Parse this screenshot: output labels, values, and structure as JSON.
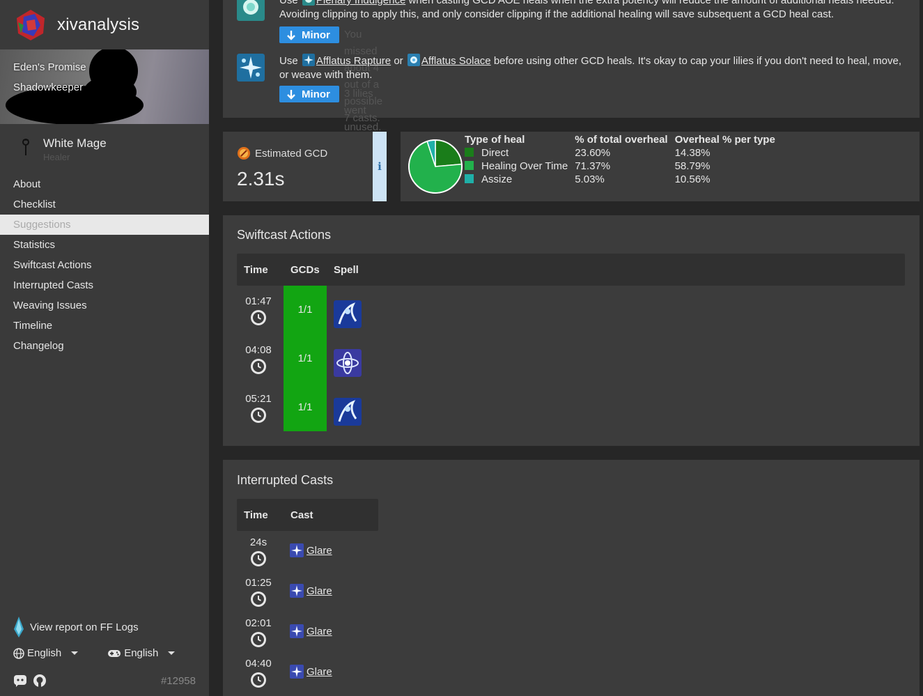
{
  "sidebar": {
    "brand": "xivanalysis",
    "fight_name": "Eden's Promise",
    "fight_sub": "Shadowkeeper",
    "job_name": "White Mage",
    "job_role": "Healer",
    "nav": [
      "About",
      "Checklist",
      "Suggestions",
      "Statistics",
      "Swiftcast Actions",
      "Interrupted Casts",
      "Weaving Issues",
      "Timeline",
      "Changelog"
    ],
    "active_nav": "Suggestions",
    "fflogs_link": "View report on FF Logs",
    "lang_ui": "English",
    "lang_game": "English",
    "version": "#12958"
  },
  "suggestions": [
    {
      "prefix": "Use",
      "spell": "Plenary Indulgence",
      "text": "when casting GCD AOE heals when the extra potency will reduce the amount of additional heals needed. Avoiding clipping to apply this, and only consider clipping if the additional healing will save subsequent a GCD heal cast.",
      "severity": "Minor",
      "note": "You missed about 4 out of a possible 7 casts."
    },
    {
      "prefix": "Use",
      "spell": "Afflatus Rapture",
      "joiner": "or",
      "spell2": "Afflatus Solace",
      "text": "before using other GCD heals. It's okay to cap your lilies if you don't need to heal, move, or weave with them.",
      "severity": "Minor",
      "note": "3 lilies went unused."
    }
  ],
  "gcd": {
    "label": "Estimated GCD",
    "value": "2.31s",
    "info": "i"
  },
  "overheal": {
    "headers": [
      "Type of heal",
      "% of total overheal",
      "Overheal % per type"
    ],
    "rows": [
      {
        "type": "Direct",
        "total": "23.60%",
        "per_type": "14.38%",
        "color": "#1a7d1a"
      },
      {
        "type": "Healing Over Time",
        "total": "71.37%",
        "per_type": "58.79%",
        "color": "#22b14c"
      },
      {
        "type": "Assize",
        "total": "5.03%",
        "per_type": "10.56%",
        "color": "#1fb0a8"
      }
    ],
    "pie": [
      23.6,
      71.37,
      5.03
    ]
  },
  "swiftcast": {
    "title": "Swiftcast Actions",
    "headers": [
      "Time",
      "GCDs",
      "Spell"
    ],
    "rows": [
      {
        "time": "01:47",
        "gcds": "1/1",
        "spell_icon": "raise-icon"
      },
      {
        "time": "04:08",
        "gcds": "1/1",
        "spell_icon": "holy-icon"
      },
      {
        "time": "05:21",
        "gcds": "1/1",
        "spell_icon": "raise-icon"
      }
    ]
  },
  "interrupted": {
    "title": "Interrupted Casts",
    "headers": [
      "Time",
      "Cast"
    ],
    "rows": [
      {
        "time": "24s",
        "cast": "Glare"
      },
      {
        "time": "01:25",
        "cast": "Glare"
      },
      {
        "time": "02:01",
        "cast": "Glare"
      },
      {
        "time": "04:40",
        "cast": "Glare"
      }
    ]
  }
}
